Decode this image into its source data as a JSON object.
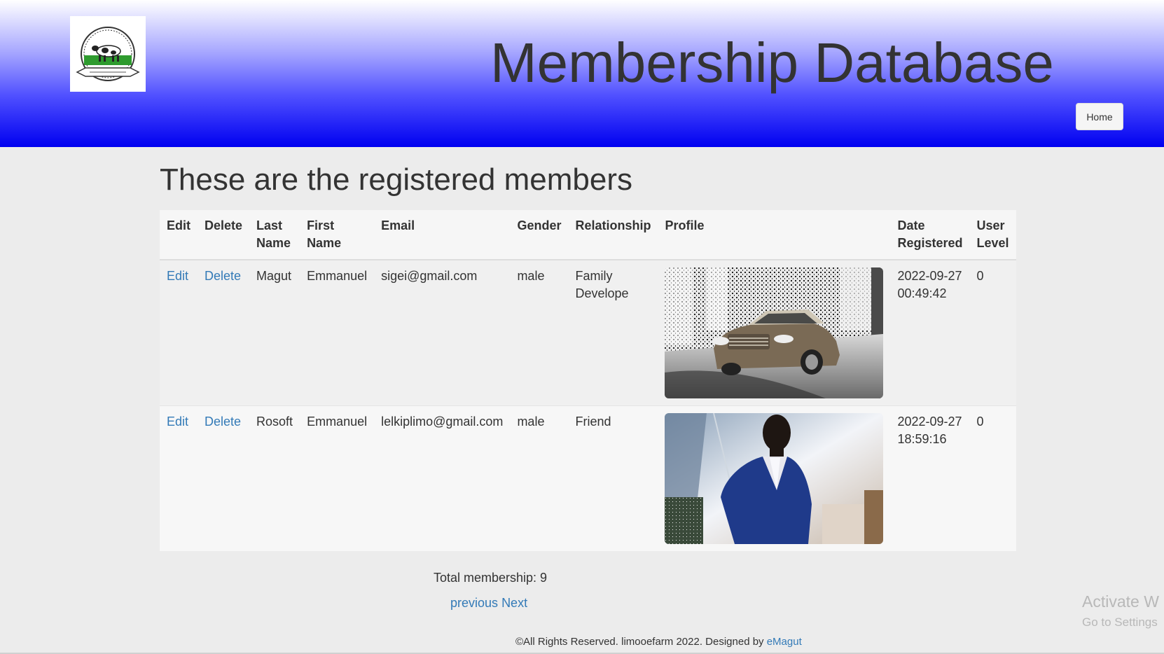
{
  "header": {
    "title": "Membership Database",
    "home_label": "Home"
  },
  "main": {
    "heading": "These are the registered members"
  },
  "table": {
    "columns": [
      "Edit",
      "Delete",
      "Last Name",
      "First Name",
      "Email",
      "Gender",
      "Relationship",
      "Profile",
      "Date Registered",
      "User Level"
    ],
    "rows": [
      {
        "edit": "Edit",
        "delete": "Delete",
        "last_name": "Magut",
        "first_name": "Emmanuel",
        "email": "sigei@gmail.com",
        "gender": "male",
        "relationship": "Family Develope",
        "date_registered": "2022-09-27 00:49:42",
        "user_level": "0"
      },
      {
        "edit": "Edit",
        "delete": "Delete",
        "last_name": "Rosoft",
        "first_name": "Emmanuel",
        "email": "lelkiplimo@gmail.com",
        "gender": "male",
        "relationship": "Friend",
        "date_registered": "2022-09-27 18:59:16",
        "user_level": "0"
      }
    ]
  },
  "summary": {
    "total": "Total membership: 9",
    "previous": "previous",
    "next": "Next"
  },
  "footer": {
    "text": "©All Rights Reserved. limooefarm 2022. Designed by ",
    "link": "eMagut"
  },
  "watermark": {
    "line1": "Activate W",
    "line2": "Go to Settings"
  },
  "colors": {
    "header_gradient_end": "#0000f0",
    "link": "#337ab7",
    "background": "#ececec"
  }
}
